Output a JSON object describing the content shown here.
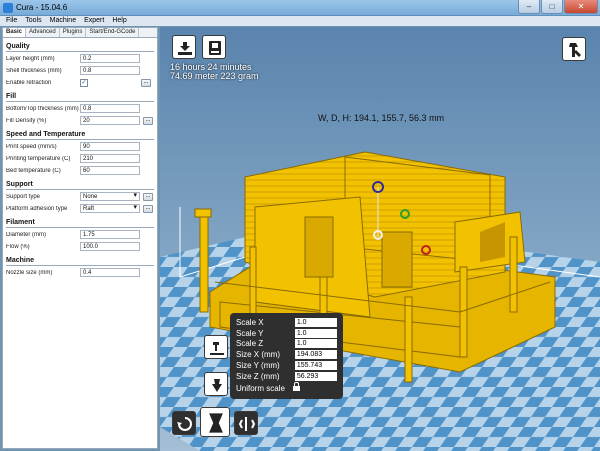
{
  "window": {
    "title": "Cura - 15.04.6",
    "minimize": "–",
    "maximize": "□",
    "close": "✕"
  },
  "menu": [
    "File",
    "Tools",
    "Machine",
    "Expert",
    "Help"
  ],
  "tabs": [
    "Basic",
    "Advanced",
    "Plugins",
    "Start/End-GCode"
  ],
  "sections": {
    "quality": {
      "title": "Quality",
      "layer_height": {
        "label": "Layer height (mm)",
        "value": "0.2"
      },
      "shell_thickness": {
        "label": "Shell thickness (mm)",
        "value": "0.8"
      },
      "enable_retraction": {
        "label": "Enable retraction",
        "checked": "✓",
        "more": "..."
      }
    },
    "fill": {
      "title": "Fill",
      "bottom_top_thickness": {
        "label": "Bottom/Top thickness (mm)",
        "value": "0.8"
      },
      "fill_density": {
        "label": "Fill Density (%)",
        "value": "20",
        "more": "..."
      }
    },
    "speed": {
      "title": "Speed and Temperature",
      "print_speed": {
        "label": "Print speed (mm/s)",
        "value": "90"
      },
      "printing_temperature": {
        "label": "Printing temperature (C)",
        "value": "210"
      },
      "bed_temperature": {
        "label": "Bed temperature (C)",
        "value": "60"
      }
    },
    "support": {
      "title": "Support",
      "support_type": {
        "label": "Support type",
        "value": "None",
        "more": "..."
      },
      "platform_adhesion": {
        "label": "Platform adhesion type",
        "value": "Raft",
        "more": "..."
      }
    },
    "filament": {
      "title": "Filament",
      "diameter": {
        "label": "Diameter (mm)",
        "value": "1.75"
      },
      "flow": {
        "label": "Flow (%)",
        "value": "100.0"
      }
    },
    "machine": {
      "title": "Machine",
      "nozzle_size": {
        "label": "Nozzle size (mm)",
        "value": "0.4"
      }
    }
  },
  "viewport": {
    "print_time": "16 hours 24 minutes",
    "print_material": "74.69 meter 223 gram",
    "dimensions": "W, D, H: 194.1, 155.7, 56.3 mm",
    "model_color": "#f2c200",
    "bed_light": "#b7d3ea",
    "bed_dark": "#4f93c9"
  },
  "scale_panel": {
    "scale_x": {
      "label": "Scale X",
      "value": "1.0"
    },
    "scale_y": {
      "label": "Scale Y",
      "value": "1.0"
    },
    "scale_z": {
      "label": "Scale Z",
      "value": "1.0"
    },
    "size_x": {
      "label": "Size X (mm)",
      "value": "194.083"
    },
    "size_y": {
      "label": "Size Y (mm)",
      "value": "155.743"
    },
    "size_z": {
      "label": "Size Z (mm)",
      "value": "56.293"
    },
    "uniform": "Uniform scale"
  },
  "icons": [
    "load-icon",
    "save-toolpath-icon",
    "view-mode-icon",
    "lay-flat-icon",
    "reset-icon",
    "rotate-icon",
    "scale-icon",
    "mirror-icon",
    "lock-icon"
  ]
}
